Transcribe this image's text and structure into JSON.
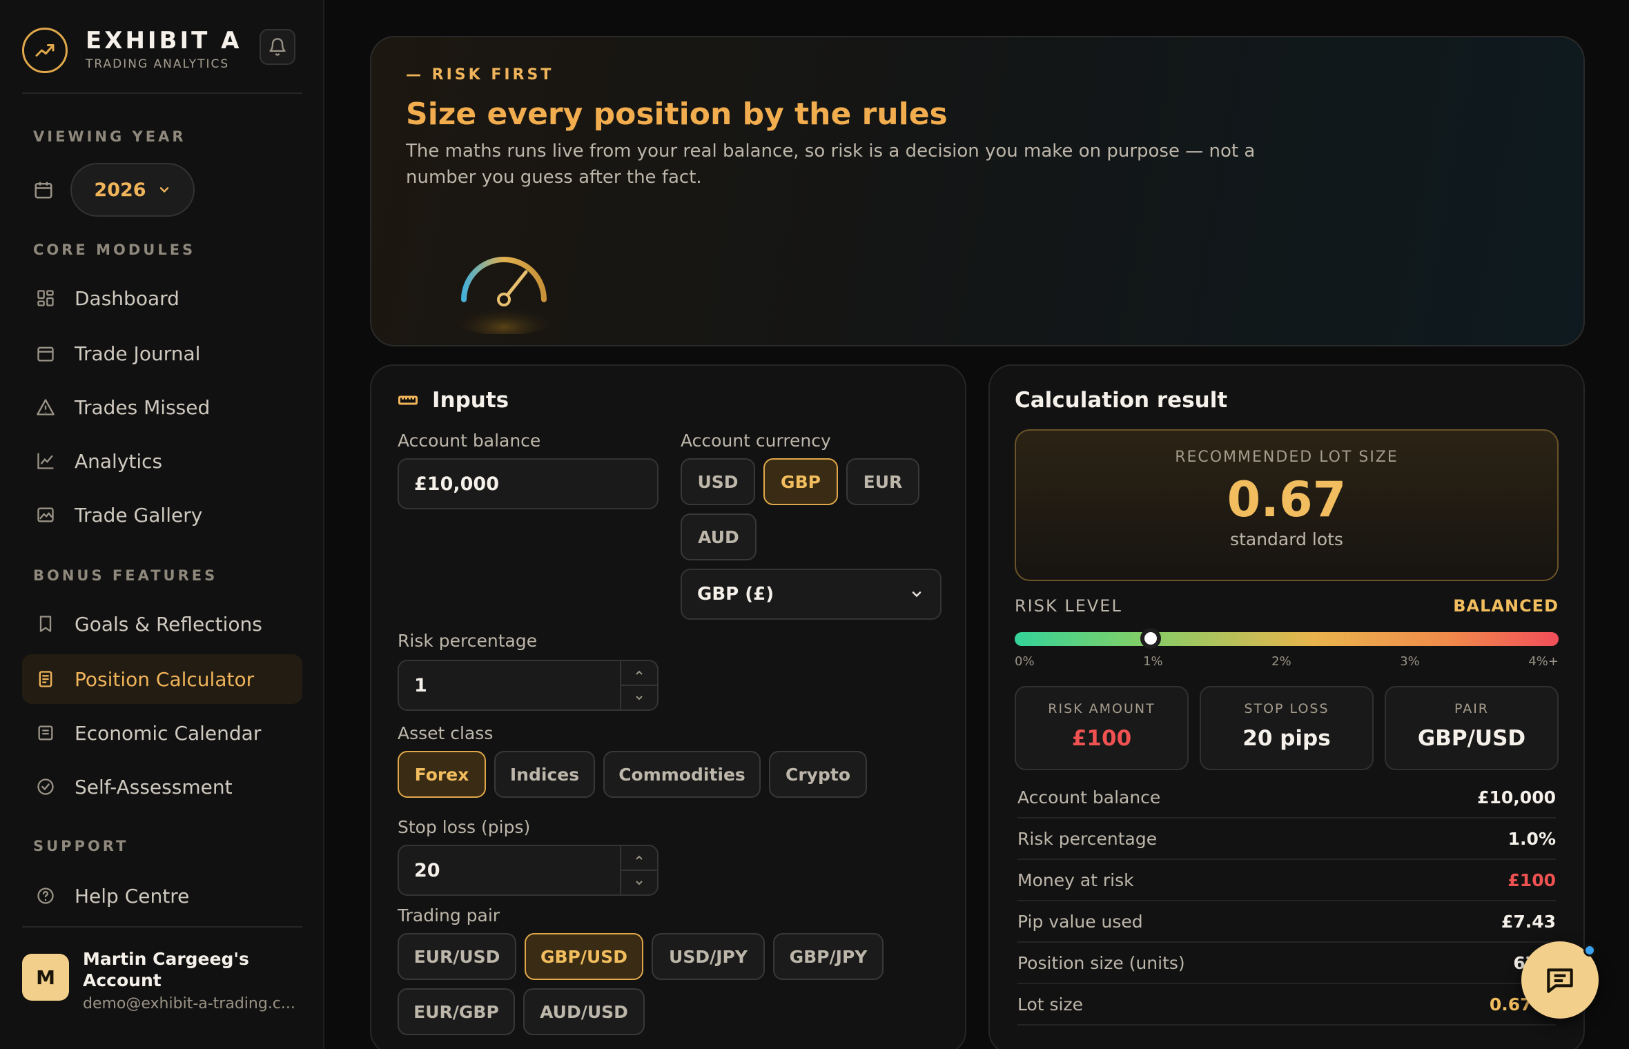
{
  "brand": {
    "title": "EXHIBIT A",
    "subtitle": "TRADING ANALYTICS"
  },
  "sidebar": {
    "viewing_year_label": "VIEWING YEAR",
    "year": "2026",
    "core_label": "CORE MODULES",
    "core_items": [
      {
        "label": "Dashboard",
        "icon": "grid-icon"
      },
      {
        "label": "Trade Journal",
        "icon": "calendar-icon"
      },
      {
        "label": "Trades Missed",
        "icon": "warning-icon"
      },
      {
        "label": "Analytics",
        "icon": "line-chart-icon"
      },
      {
        "label": "Trade Gallery",
        "icon": "image-icon"
      }
    ],
    "bonus_label": "BONUS FEATURES",
    "bonus_items": [
      {
        "label": "Goals & Reflections",
        "icon": "bookmark-icon"
      },
      {
        "label": "Position Calculator",
        "icon": "calculator-icon",
        "active": true
      },
      {
        "label": "Economic Calendar",
        "icon": "news-icon"
      },
      {
        "label": "Self-Assessment",
        "icon": "check-circle-icon"
      }
    ],
    "support_label": "SUPPORT",
    "support_items": [
      {
        "label": "Help Centre",
        "icon": "help-circle-icon"
      }
    ],
    "account": {
      "initial": "M",
      "name": "Martin Cargeeg's Account",
      "email": "demo@exhibit-a-trading.c..."
    }
  },
  "hero": {
    "kicker": "— RISK FIRST",
    "title": "Size every position by the rules",
    "description": "The maths runs live from your real balance, so risk is a decision you make on purpose — not a number you guess after the fact."
  },
  "inputs": {
    "title": "Inputs",
    "balance_label": "Account balance",
    "balance_value": "£10,000",
    "currency_label": "Account currency",
    "currencies": [
      "USD",
      "GBP",
      "EUR",
      "AUD"
    ],
    "currency_selected": "GBP",
    "currency_select_value": "GBP (£)",
    "risk_label": "Risk percentage",
    "risk_value": "1",
    "asset_label": "Asset class",
    "assets": [
      "Forex",
      "Indices",
      "Commodities",
      "Crypto"
    ],
    "asset_selected": "Forex",
    "stop_label": "Stop loss (pips)",
    "stop_value": "20",
    "pair_label": "Trading pair",
    "pairs": [
      "EUR/USD",
      "GBP/USD",
      "USD/JPY",
      "GBP/JPY",
      "EUR/GBP",
      "AUD/USD"
    ],
    "pair_selected": "GBP/USD"
  },
  "result": {
    "title": "Calculation result",
    "rec_label": "RECOMMENDED LOT SIZE",
    "rec_value": "0.67",
    "rec_unit": "standard lots",
    "risk_level_label": "RISK LEVEL",
    "risk_level_value": "BALANCED",
    "risk_percent": 1.0,
    "risk_scale_max": 4,
    "risk_ticks": [
      "0%",
      "1%",
      "2%",
      "3%",
      "4%+"
    ],
    "cards": [
      {
        "label": "RISK AMOUNT",
        "value": "£100",
        "color": "#f05252"
      },
      {
        "label": "STOP LOSS",
        "value": "20 pips",
        "color": "#f5f1ea"
      },
      {
        "label": "PAIR",
        "value": "GBP/USD",
        "color": "#f5f1ea"
      }
    ],
    "rows": [
      {
        "key": "Account balance",
        "value": "£10,000",
        "color": "#f5f1ea"
      },
      {
        "key": "Risk percentage",
        "value": "1.0%",
        "color": "#f5f1ea"
      },
      {
        "key": "Money at risk",
        "value": "£100",
        "color": "#f05252"
      },
      {
        "key": "Pip value used",
        "value": "£7.43",
        "color": "#f5f1ea"
      },
      {
        "key": "Position size (units)",
        "value": "67,2",
        "color": "#f5f1ea"
      },
      {
        "key": "Lot size",
        "value": "0.67 lo",
        "color": "#f2bd5e"
      }
    ]
  },
  "colors": {
    "accent": "#f0b45a",
    "danger": "#f05252",
    "background": "#0b0b0b"
  }
}
